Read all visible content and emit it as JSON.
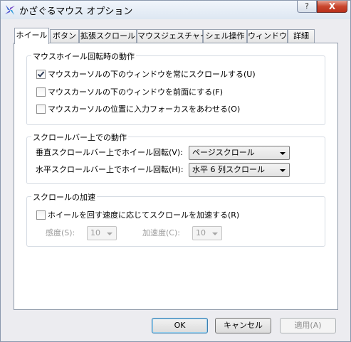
{
  "window": {
    "title": "かざぐるマウス オプション"
  },
  "titlebar": {
    "help_label": "?",
    "close_label": "X"
  },
  "tabs": [
    {
      "label": "ホイール"
    },
    {
      "label": "ボタン"
    },
    {
      "label": "拡張スクロール"
    },
    {
      "label": "マウスジェスチャー"
    },
    {
      "label": "シェル操作"
    },
    {
      "label": "ウィンドウ"
    },
    {
      "label": "詳細"
    }
  ],
  "wheel_group": {
    "title": "マウスホイール回転時の動作",
    "options": [
      {
        "label": "マウスカーソルの下のウィンドウを常にスクロールする(U)",
        "checked": true
      },
      {
        "label": "マウスカーソルの下のウィンドウを前面にする(F)",
        "checked": false
      },
      {
        "label": "マウスカーソルの位置に入力フォーカスをあわせる(O)",
        "checked": false
      }
    ]
  },
  "scrollbar_group": {
    "title": "スクロールバー上での動作",
    "vertical_label": "垂直スクロールバー上でホイール回転(V):",
    "vertical_value": "ページスクロール",
    "horizontal_label": "水平スクロールバー上でホイール回転(H):",
    "horizontal_value": "水平 6 列スクロール"
  },
  "accel_group": {
    "title": "スクロールの加速",
    "accel_checkbox_label": "ホイールを回す速度に応じてスクロールを加速する(R)",
    "accel_checked": false,
    "sensitivity_label": "感度(S):",
    "sensitivity_value": "10",
    "acceleration_label": "加速度(C):",
    "acceleration_value": "10"
  },
  "buttons": {
    "ok": "OK",
    "cancel": "キャンセル",
    "apply": "適用(A)"
  }
}
